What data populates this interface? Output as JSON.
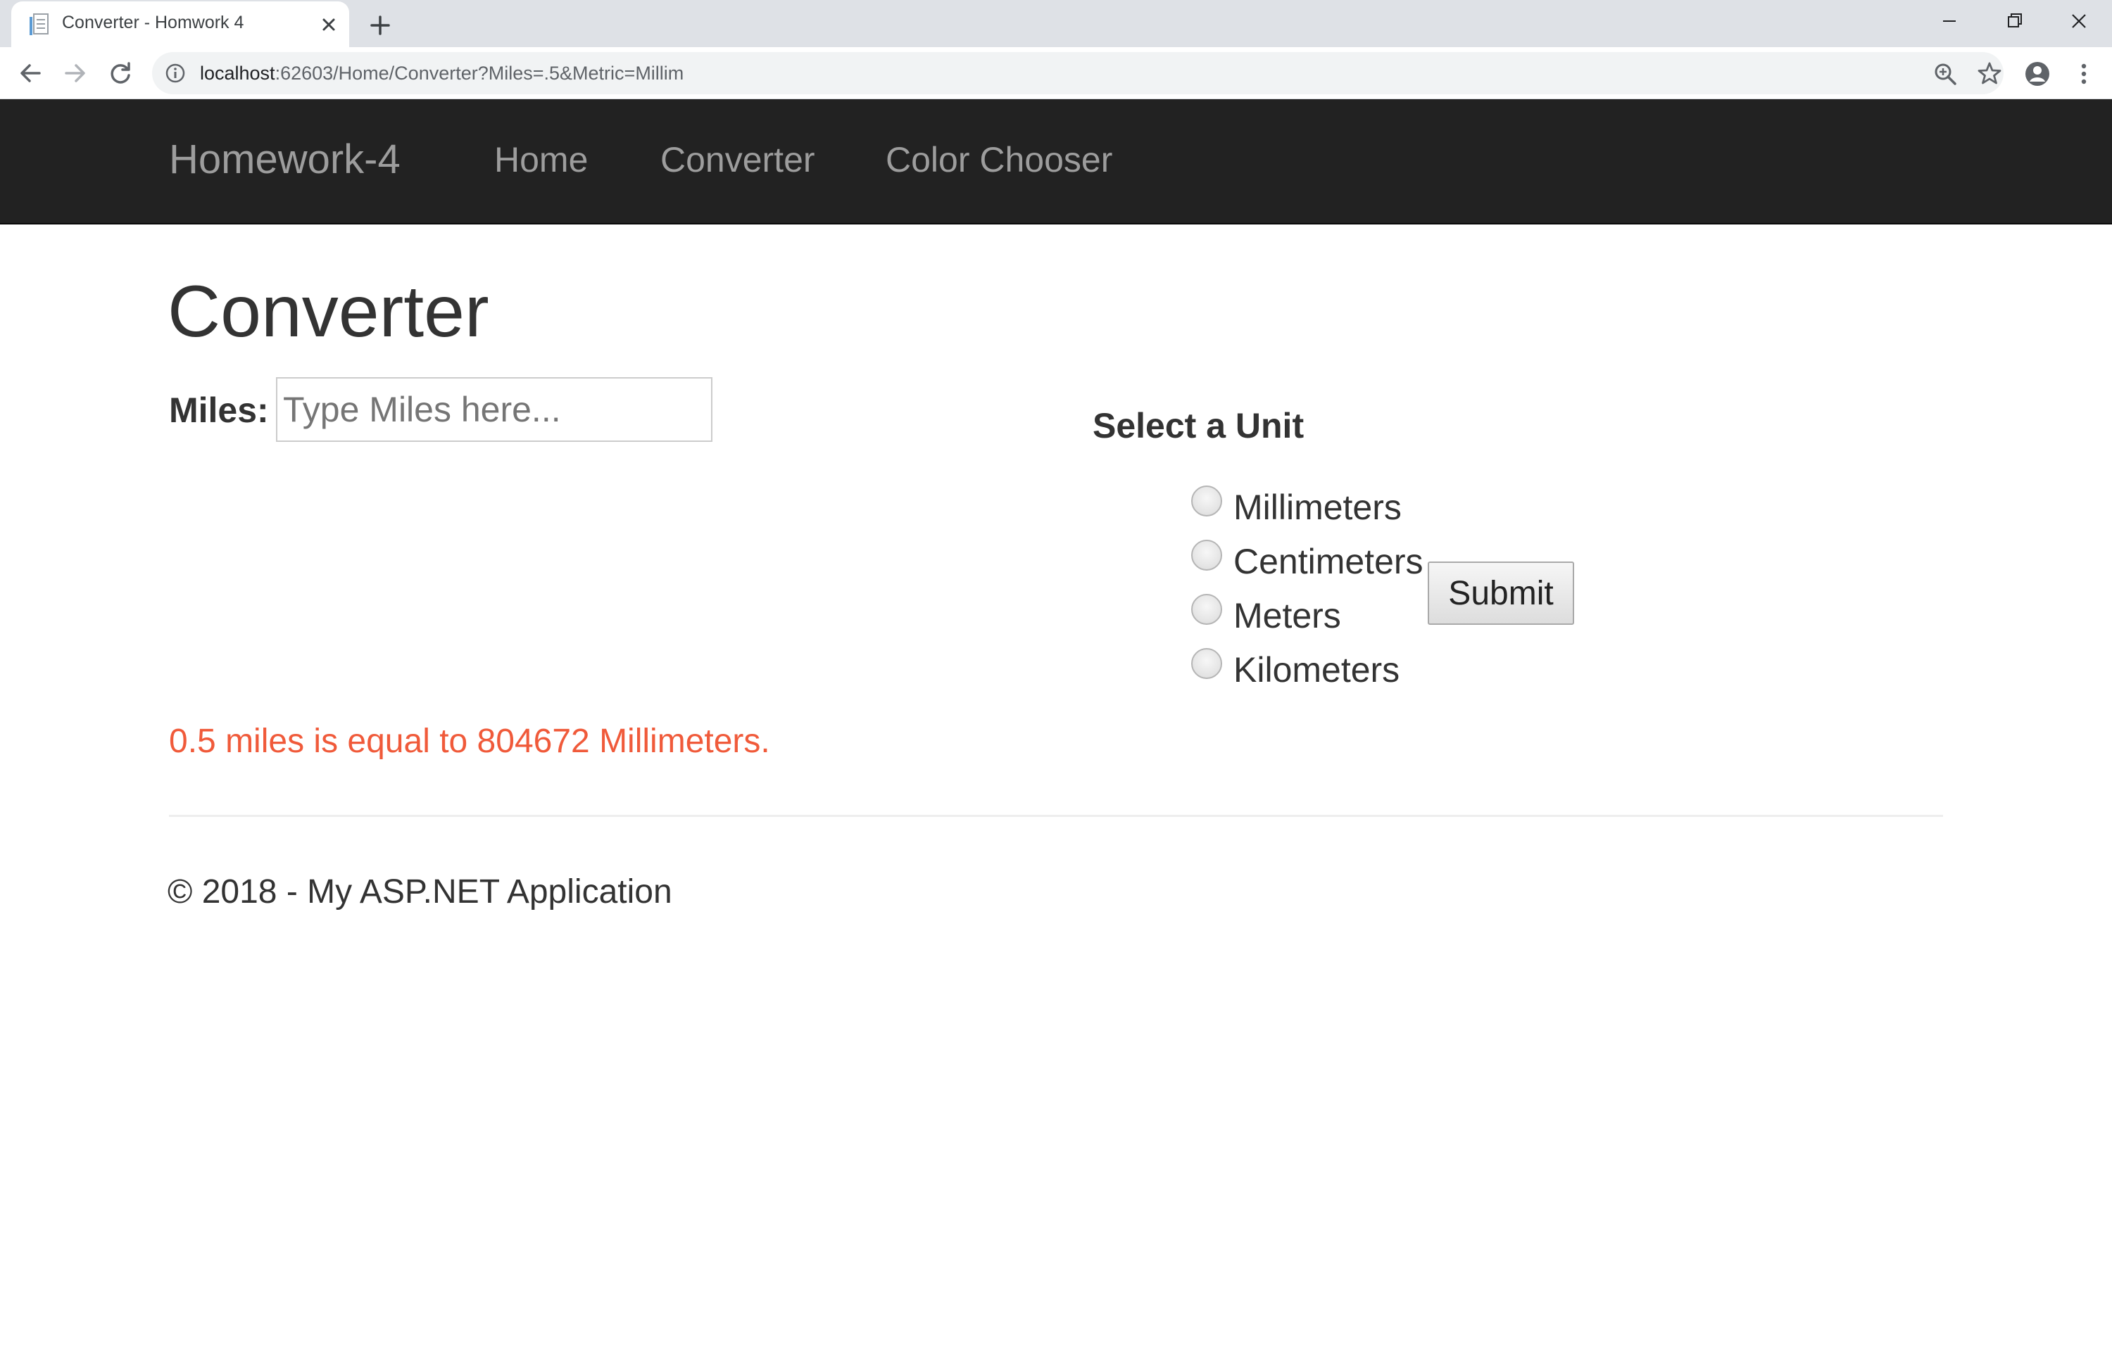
{
  "browser": {
    "tab_title": "Converter - Homwork 4",
    "url_host": "localhost",
    "url_rest": ":62603/Home/Converter?Miles=.5&Metric=Millim"
  },
  "navbar": {
    "brand": "Homework-4",
    "links": [
      {
        "label": "Home"
      },
      {
        "label": "Converter"
      },
      {
        "label": "Color Chooser"
      }
    ]
  },
  "page": {
    "title": "Converter",
    "miles_label": "Miles:",
    "miles_input": {
      "value": "",
      "placeholder": "Type Miles here..."
    },
    "unit_heading": "Select a Unit",
    "units": [
      {
        "label": "Millimeters",
        "checked": false
      },
      {
        "label": "Centimeters",
        "checked": false
      },
      {
        "label": "Meters",
        "checked": false
      },
      {
        "label": "Kilometers",
        "checked": false
      }
    ],
    "submit_label": "Submit",
    "result_text": "0.5 miles is equal to 804672 Millimeters.",
    "footer": "© 2018 - My ASP.NET Application"
  },
  "colors": {
    "navbar_bg": "#222222",
    "navbar_text": "#9d9d9d",
    "result_text": "#f05a3a",
    "tabstrip_bg": "#dee1e6"
  }
}
